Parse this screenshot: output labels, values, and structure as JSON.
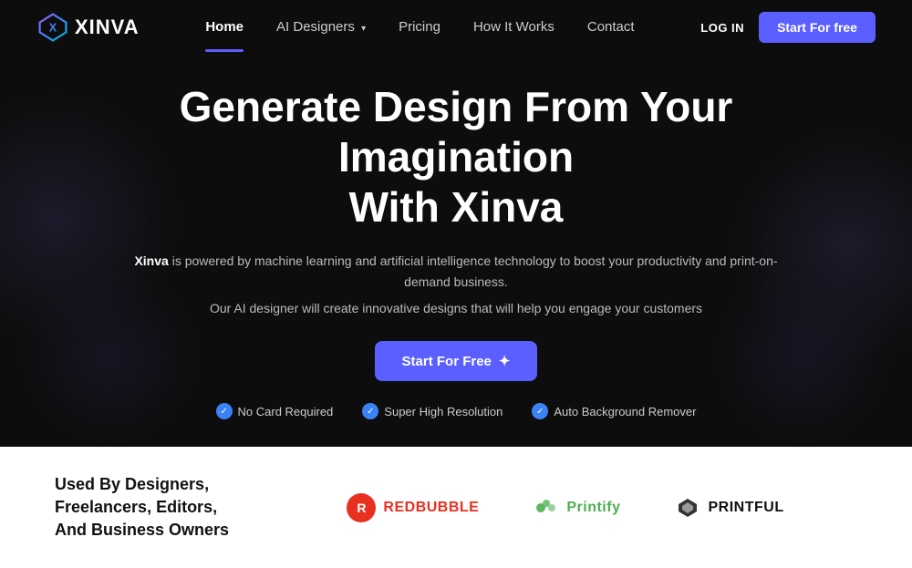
{
  "brand": {
    "name": "XINVA",
    "logo_text": "XINVA"
  },
  "nav": {
    "links": [
      {
        "label": "Home",
        "active": true,
        "has_dropdown": false
      },
      {
        "label": "AI Designers",
        "active": false,
        "has_dropdown": true
      },
      {
        "label": "Pricing",
        "active": false,
        "has_dropdown": false
      },
      {
        "label": "How It Works",
        "active": false,
        "has_dropdown": false
      },
      {
        "label": "Contact",
        "active": false,
        "has_dropdown": false
      }
    ],
    "login_label": "LOG IN",
    "cta_label": "Start For free"
  },
  "hero": {
    "title_line1": "Generate Design From Your Imagination",
    "title_line2": "With Xinva",
    "subtitle_brand": "Xinva",
    "subtitle_text": " is powered by machine learning and artificial intelligence technology to boost your productivity and print-on-demand business.",
    "description": "Our AI designer will create innovative designs that will help you engage your customers",
    "cta_label": "Start For Free",
    "cta_icon": "✦",
    "badges": [
      {
        "label": "No Card Required"
      },
      {
        "label": "Super High Resolution"
      },
      {
        "label": "Auto Background Remover"
      }
    ]
  },
  "bottom": {
    "title": "Used By Designers, Freelancers, Editors, And Business Owners",
    "brands": [
      {
        "name": "REDBUBBLE",
        "type": "redbubble"
      },
      {
        "name": "Printify",
        "type": "printify"
      },
      {
        "name": "PRINTFUL",
        "type": "printful"
      }
    ]
  }
}
